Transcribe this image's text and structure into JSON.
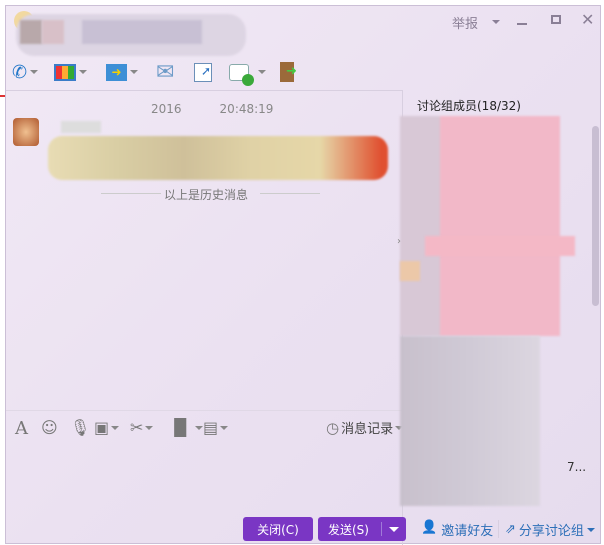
{
  "titlebar": {
    "report_label": "举报",
    "minimize": "minimize",
    "maximize": "maximize",
    "close": "close"
  },
  "toolbar": {
    "icons": [
      "phone-icon",
      "screen-share-icon",
      "file-transfer-icon",
      "mail-icon",
      "note-icon",
      "add-chat-icon",
      "exit-group-icon"
    ]
  },
  "chat": {
    "timestamp_date": "2016",
    "timestamp_time": "20:48:19",
    "history_divider": "以上是历史消息"
  },
  "input_toolbar": {
    "history_label": "消息记录"
  },
  "buttons": {
    "close": "关闭(C)",
    "send": "发送(S)"
  },
  "members": {
    "title": "讨论组成员(18/32)",
    "truncated_name": "7..."
  },
  "footer": {
    "invite": "邀请好友",
    "share": "分享讨论组"
  },
  "colors": {
    "accent": "#7a36c4",
    "link": "#2d6fb8"
  }
}
